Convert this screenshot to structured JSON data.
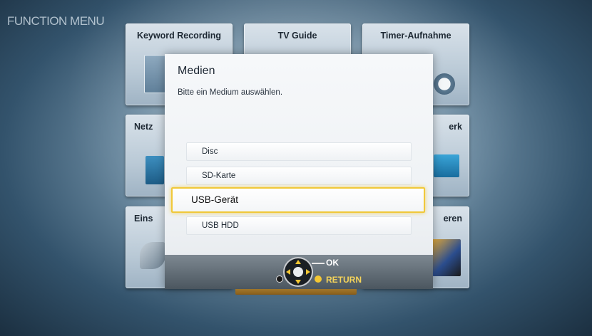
{
  "screen": {
    "title": "FUNCTION MENU"
  },
  "tiles": {
    "keyword_recording": "Keyword Recording",
    "tv_guide": "TV Guide",
    "timer_recording": "Timer-Aufnahme",
    "network_left": "Netz",
    "network_right": "erk",
    "settings_left": "Eins",
    "settings_right": "eren"
  },
  "dialog": {
    "title": "Medien",
    "subtitle": "Bitte ein Medium auswählen.",
    "options": [
      {
        "label": "Disc",
        "selected": false
      },
      {
        "label": "SD-Karte",
        "selected": false
      },
      {
        "label": "USB-Gerät",
        "selected": true
      },
      {
        "label": "USB HDD",
        "selected": false
      }
    ],
    "footer": {
      "ok_label": "OK",
      "return_label": "RETURN"
    }
  },
  "colors": {
    "highlight": "#f0c83a",
    "return_color": "#f4c733"
  },
  "icons": {
    "navigation": "dpad-controller-icon",
    "return": "yellow-circle-icon"
  }
}
